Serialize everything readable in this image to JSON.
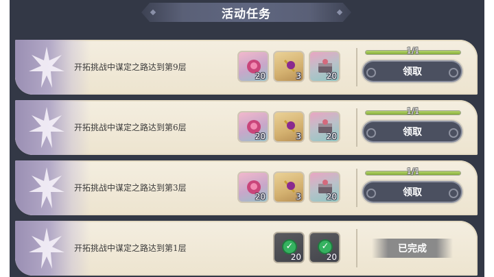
{
  "header": {
    "title": "活动任务"
  },
  "tasks": [
    {
      "text": "开拓挑战中谋定之路达到第9层",
      "rewards": [
        {
          "icon": "rose-crystal-icon",
          "count": "20"
        },
        {
          "icon": "potion-key-icon",
          "count": "3"
        },
        {
          "icon": "treasure-chest-icon",
          "count": "20"
        }
      ],
      "progress_text": "1/1",
      "progress_value": 1.0,
      "button": "领取",
      "completed": false
    },
    {
      "text": "开拓挑战中谋定之路达到第6层",
      "rewards": [
        {
          "icon": "rose-crystal-icon",
          "count": "20"
        },
        {
          "icon": "potion-key-icon",
          "count": "3"
        },
        {
          "icon": "treasure-chest-icon",
          "count": "20"
        }
      ],
      "progress_text": "1/1",
      "progress_value": 1.0,
      "button": "领取",
      "completed": false
    },
    {
      "text": "开拓挑战中谋定之路达到第3层",
      "rewards": [
        {
          "icon": "rose-crystal-icon",
          "count": "20"
        },
        {
          "icon": "potion-key-icon",
          "count": "3"
        },
        {
          "icon": "treasure-chest-icon",
          "count": "20"
        }
      ],
      "progress_text": "1/1",
      "progress_value": 1.0,
      "button": "领取",
      "completed": false
    },
    {
      "text": "开拓挑战中谋定之路达到第1层",
      "rewards": [
        {
          "icon": "rose-crystal-icon",
          "count": "20",
          "claimed": true
        },
        {
          "icon": "treasure-chest-icon",
          "count": "20",
          "claimed": true
        }
      ],
      "status": "已完成",
      "completed": true
    }
  ],
  "colors": {
    "panel_bg": "#333846",
    "row_bg": "#f4eee0",
    "button_bg": "#4b5060",
    "progress_fill": "#9dc150",
    "check_green": "#35b260"
  }
}
